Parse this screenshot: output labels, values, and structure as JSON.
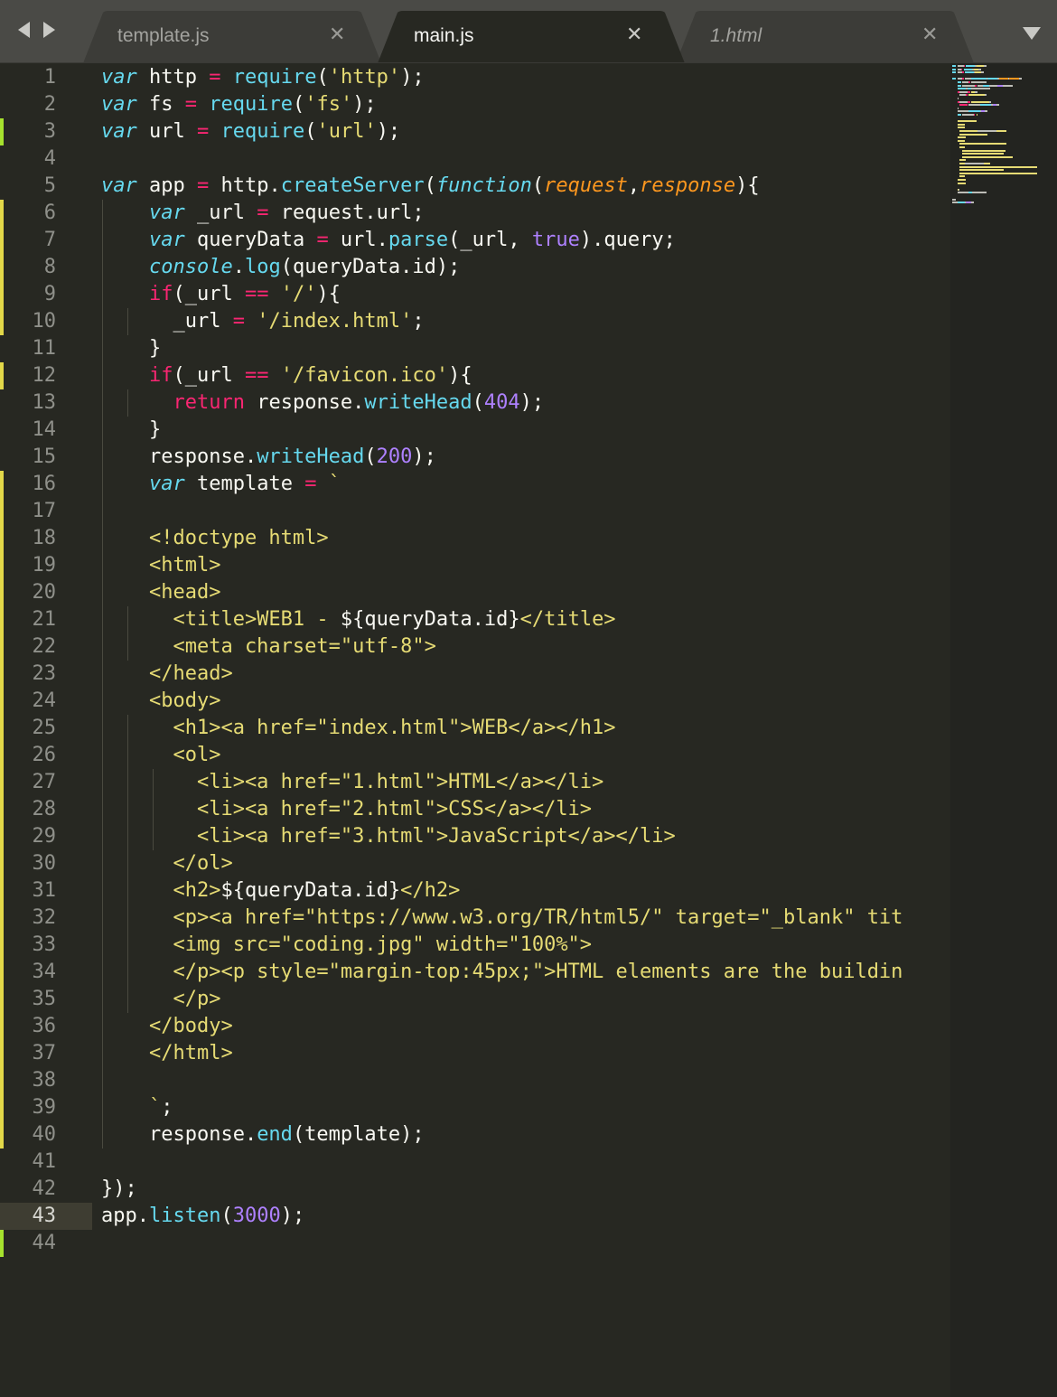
{
  "navigation": {
    "back_label": "◀",
    "forward_label": "▶"
  },
  "tabs": [
    {
      "label": "template.js",
      "close_label": "✕",
      "active": false,
      "italic": false
    },
    {
      "label": "main.js",
      "close_label": "✕",
      "active": true,
      "italic": false
    },
    {
      "label": "1.html",
      "close_label": "✕",
      "active": false,
      "italic": true
    }
  ],
  "editor": {
    "current_line": 43,
    "git_modified_lines": [
      3,
      6,
      7,
      8,
      9,
      10,
      12,
      16,
      17,
      18,
      19,
      20,
      21,
      22,
      23,
      24,
      25,
      26,
      27,
      28,
      29,
      30,
      31,
      32,
      33,
      34,
      35,
      36,
      37,
      38,
      39,
      40,
      44
    ],
    "lines": [
      [
        [
          "var",
          "k"
        ],
        [
          " http ",
          "tx"
        ],
        [
          "=",
          "op"
        ],
        [
          " ",
          "tx"
        ],
        [
          "require",
          "fn"
        ],
        [
          "(",
          "tx"
        ],
        [
          "'http'",
          "st"
        ],
        [
          ");",
          "tx"
        ]
      ],
      [
        [
          "var",
          "k"
        ],
        [
          " fs ",
          "tx"
        ],
        [
          "=",
          "op"
        ],
        [
          " ",
          "tx"
        ],
        [
          "require",
          "fn"
        ],
        [
          "(",
          "tx"
        ],
        [
          "'fs'",
          "st"
        ],
        [
          ");",
          "tx"
        ]
      ],
      [
        [
          "var",
          "k"
        ],
        [
          " url ",
          "tx"
        ],
        [
          "=",
          "op"
        ],
        [
          " ",
          "tx"
        ],
        [
          "require",
          "fn"
        ],
        [
          "(",
          "tx"
        ],
        [
          "'url'",
          "st"
        ],
        [
          ");",
          "tx"
        ]
      ],
      [],
      [
        [
          "var",
          "k"
        ],
        [
          " app ",
          "tx"
        ],
        [
          "=",
          "op"
        ],
        [
          " http.",
          "tx"
        ],
        [
          "createServer",
          "fn"
        ],
        [
          "(",
          "tx"
        ],
        [
          "function",
          "k"
        ],
        [
          "(",
          "tx"
        ],
        [
          "request",
          "pa"
        ],
        [
          ",",
          "tx"
        ],
        [
          "response",
          "pa"
        ],
        [
          "){",
          "tx"
        ]
      ],
      [
        [
          "    ",
          "tx"
        ],
        [
          "var",
          "k"
        ],
        [
          " _url ",
          "tx"
        ],
        [
          "=",
          "op"
        ],
        [
          " request.url;",
          "tx"
        ]
      ],
      [
        [
          "    ",
          "tx"
        ],
        [
          "var",
          "k"
        ],
        [
          " queryData ",
          "tx"
        ],
        [
          "=",
          "op"
        ],
        [
          " url.",
          "tx"
        ],
        [
          "parse",
          "fn"
        ],
        [
          "(_url, ",
          "tx"
        ],
        [
          "true",
          "nu"
        ],
        [
          ").query;",
          "tx"
        ]
      ],
      [
        [
          "    ",
          "tx"
        ],
        [
          "console",
          "k"
        ],
        [
          ".",
          "tx"
        ],
        [
          "log",
          "fn"
        ],
        [
          "(queryData.id);",
          "tx"
        ]
      ],
      [
        [
          "    ",
          "tx"
        ],
        [
          "if",
          "kw"
        ],
        [
          "(_url ",
          "tx"
        ],
        [
          "==",
          "op"
        ],
        [
          " ",
          "tx"
        ],
        [
          "'/'",
          "st"
        ],
        [
          "){",
          "tx"
        ]
      ],
      [
        [
          "      _url ",
          "tx"
        ],
        [
          "=",
          "op"
        ],
        [
          " ",
          "tx"
        ],
        [
          "'/index.html'",
          "st"
        ],
        [
          ";",
          "tx"
        ]
      ],
      [
        [
          "    }",
          "tx"
        ]
      ],
      [
        [
          "    ",
          "tx"
        ],
        [
          "if",
          "kw"
        ],
        [
          "(_url ",
          "tx"
        ],
        [
          "==",
          "op"
        ],
        [
          " ",
          "tx"
        ],
        [
          "'/favicon.ico'",
          "st"
        ],
        [
          "){",
          "tx"
        ]
      ],
      [
        [
          "      ",
          "tx"
        ],
        [
          "return",
          "kw"
        ],
        [
          " response.",
          "tx"
        ],
        [
          "writeHead",
          "fn"
        ],
        [
          "(",
          "tx"
        ],
        [
          "404",
          "nu"
        ],
        [
          ");",
          "tx"
        ]
      ],
      [
        [
          "    }",
          "tx"
        ]
      ],
      [
        [
          "    response.",
          "tx"
        ],
        [
          "writeHead",
          "fn"
        ],
        [
          "(",
          "tx"
        ],
        [
          "200",
          "nu"
        ],
        [
          ");",
          "tx"
        ]
      ],
      [
        [
          "    ",
          "tx"
        ],
        [
          "var",
          "k"
        ],
        [
          " template ",
          "tx"
        ],
        [
          "=",
          "op"
        ],
        [
          " ",
          "tx"
        ],
        [
          "`",
          "st"
        ]
      ],
      [],
      [
        [
          "    <!doctype html>",
          "st"
        ]
      ],
      [
        [
          "    <html>",
          "st"
        ]
      ],
      [
        [
          "    <head>",
          "st"
        ]
      ],
      [
        [
          "      <title>WEB1 - ",
          "st"
        ],
        [
          "${queryData.id}",
          "tx"
        ],
        [
          "</title>",
          "st"
        ]
      ],
      [
        [
          "      <meta charset=\"utf-8\">",
          "st"
        ]
      ],
      [
        [
          "    </head>",
          "st"
        ]
      ],
      [
        [
          "    <body>",
          "st"
        ]
      ],
      [
        [
          "      <h1><a href=\"index.html\">WEB</a></h1>",
          "st"
        ]
      ],
      [
        [
          "      <ol>",
          "st"
        ]
      ],
      [
        [
          "        <li><a href=\"1.html\">HTML</a></li>",
          "st"
        ]
      ],
      [
        [
          "        <li><a href=\"2.html\">CSS</a></li>",
          "st"
        ]
      ],
      [
        [
          "        <li><a href=\"3.html\">JavaScript</a></li>",
          "st"
        ]
      ],
      [
        [
          "      </ol>",
          "st"
        ]
      ],
      [
        [
          "      <h2>",
          "st"
        ],
        [
          "${queryData.id}",
          "tx"
        ],
        [
          "</h2>",
          "st"
        ]
      ],
      [
        [
          "      <p><a href=\"https://www.w3.org/TR/html5/\" target=\"_blank\" tit",
          "st"
        ]
      ],
      [
        [
          "      <img src=\"coding.jpg\" width=\"100%\">",
          "st"
        ]
      ],
      [
        [
          "      </p><p style=\"margin-top:45px;\">HTML elements are the buildin",
          "st"
        ]
      ],
      [
        [
          "      </p>",
          "st"
        ]
      ],
      [
        [
          "    </body>",
          "st"
        ]
      ],
      [
        [
          "    </html>",
          "st"
        ]
      ],
      [],
      [
        [
          "    `",
          "st"
        ],
        [
          ";",
          "tx"
        ]
      ],
      [
        [
          "    response.",
          "tx"
        ],
        [
          "end",
          "fn"
        ],
        [
          "(template);",
          "tx"
        ]
      ],
      [],
      [
        [
          "});",
          "tx"
        ]
      ],
      [
        [
          "app.",
          "tx"
        ],
        [
          "listen",
          "fn"
        ],
        [
          "(",
          "tx"
        ],
        [
          "3000",
          "nu"
        ],
        [
          ");",
          "tx"
        ]
      ],
      []
    ]
  },
  "colors": {
    "background": "#272822",
    "tabbar": "#4a4a46",
    "inactive_tab": "#3c3c38",
    "gutter_current": "#3e3d32",
    "git_modified": "#e2d849",
    "git_added": "#a6e22e",
    "minimap": "#232420"
  }
}
